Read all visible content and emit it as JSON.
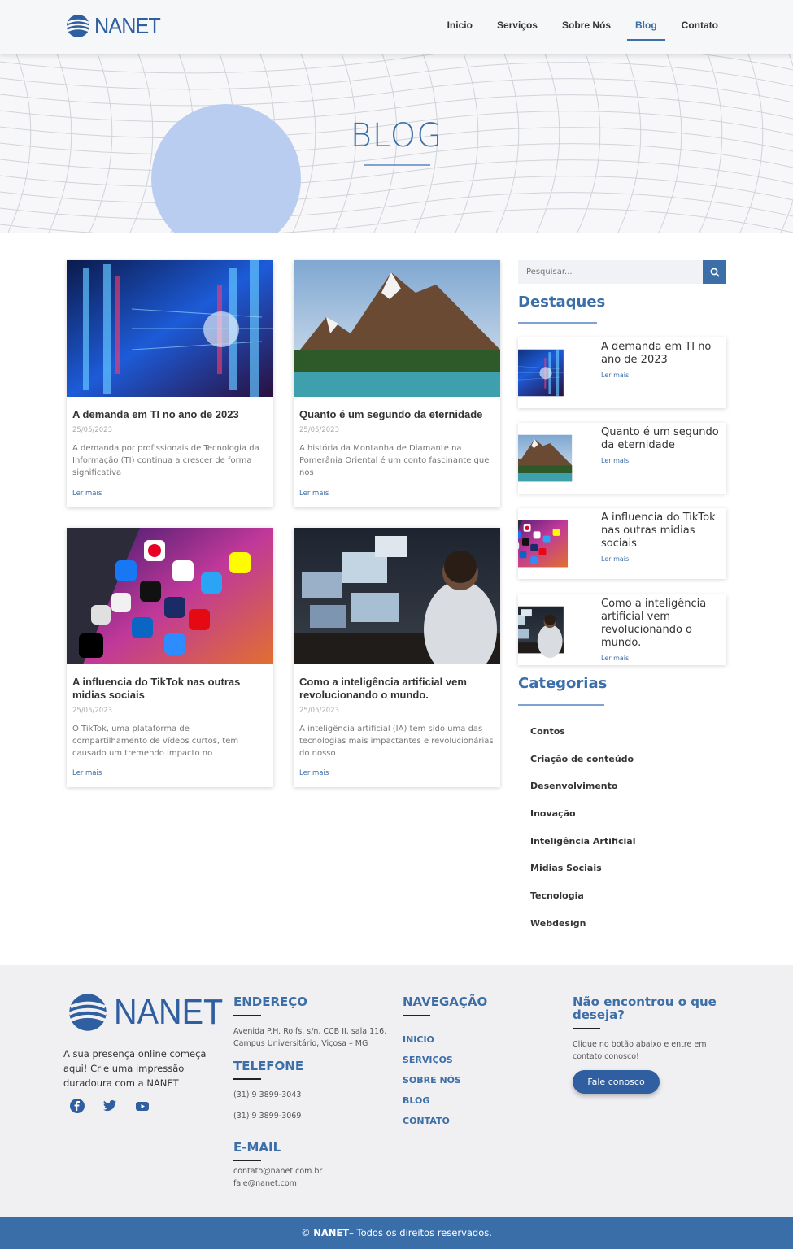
{
  "header": {
    "logo": "NANET",
    "nav": [
      "Inicio",
      "Serviços",
      "Sobre Nós",
      "Blog",
      "Contato"
    ],
    "active": "Blog"
  },
  "hero": {
    "title": "BLOG"
  },
  "posts": [
    {
      "title": "A demanda em TI no ano de 2023",
      "date": "25/05/2023",
      "excerpt": "A demanda por profissionais de Tecnologia da Informação (TI) continua a crescer de forma significativa",
      "more": "Ler mais",
      "image": "server-room"
    },
    {
      "title": "Quanto é um segundo da eternidade",
      "date": "25/05/2023",
      "excerpt": "A história da Montanha de Diamante na Pomerânia Oriental é um conto fascinante que nos",
      "more": "Ler mais",
      "image": "mountain-lake"
    },
    {
      "title": "A influencia do TikTok nas outras midias sociais",
      "date": "25/05/2023",
      "excerpt": "O TikTok, uma plataforma de compartilhamento de vídeos curtos, tem causado um tremendo impacto no",
      "more": "Ler mais",
      "image": "phone-apps"
    },
    {
      "title": "Como a inteligência artificial vem revolucionando o mundo.",
      "date": "25/05/2023",
      "excerpt": "A inteligência artificial (IA) tem sido uma das tecnologias mais impactantes e revolucionárias do nosso",
      "more": "Ler mais",
      "image": "control-room"
    }
  ],
  "sidebar": {
    "search_placeholder": "Pesquisar...",
    "featured_heading": "Destaques",
    "featured": [
      {
        "title": "A demanda em TI no ano de 2023",
        "more": "Ler mais"
      },
      {
        "title": "Quanto é um segundo da eternidade",
        "more": "Ler mais"
      },
      {
        "title": "A influencia do TikTok nas outras midias sociais",
        "more": "Ler mais"
      },
      {
        "title": "Como a inteligência artificial vem revolucionando o mundo.",
        "more": "Ler mais"
      }
    ],
    "categories_heading": "Categorias",
    "categories": [
      "Contos",
      "Criação de conteúdo",
      "Desenvolvimento",
      "Inovação",
      "Inteligência Artificial",
      "Midias Sociais",
      "Tecnologia",
      "Webdesign"
    ]
  },
  "footer": {
    "logo": "NANET",
    "tagline": "A sua presença online começa aqui! Crie uma impressão duradoura com a NANET",
    "address_heading": "ENDEREÇO",
    "address": "Avenida P.H. Rolfs, s/n. CCB II, sala 116. Campus Universitário, Viçosa – MG",
    "phone_heading": "TELEFONE",
    "phone1": "(31) 9 3899-3043",
    "phone2": "(31) 9 3899-3069",
    "email_heading": "E-MAIL",
    "email1": "contato@nanet.com.br",
    "email2": "fale@nanet.com",
    "nav_heading": "NAVEGAÇÃO",
    "nav": [
      "INICIO",
      "SERVIÇOS",
      "SOBRE NÓS",
      "BLOG",
      "CONTATO"
    ],
    "cta_heading": "Não encontrou o que deseja?",
    "cta_text": "Clique no botão abaixo e entre em contato conosco!",
    "cta_button": "Fale conosco",
    "socials": [
      "facebook-icon",
      "twitter-icon",
      "youtube-icon"
    ]
  },
  "copyright": {
    "symbol": "©",
    "brand": "NANET",
    "text": "– Todos os direitos reservados."
  },
  "colors": {
    "primary": "#3c6ea8",
    "dark_primary": "#2f5fa0",
    "bottom_bar": "#3a6ea9"
  }
}
